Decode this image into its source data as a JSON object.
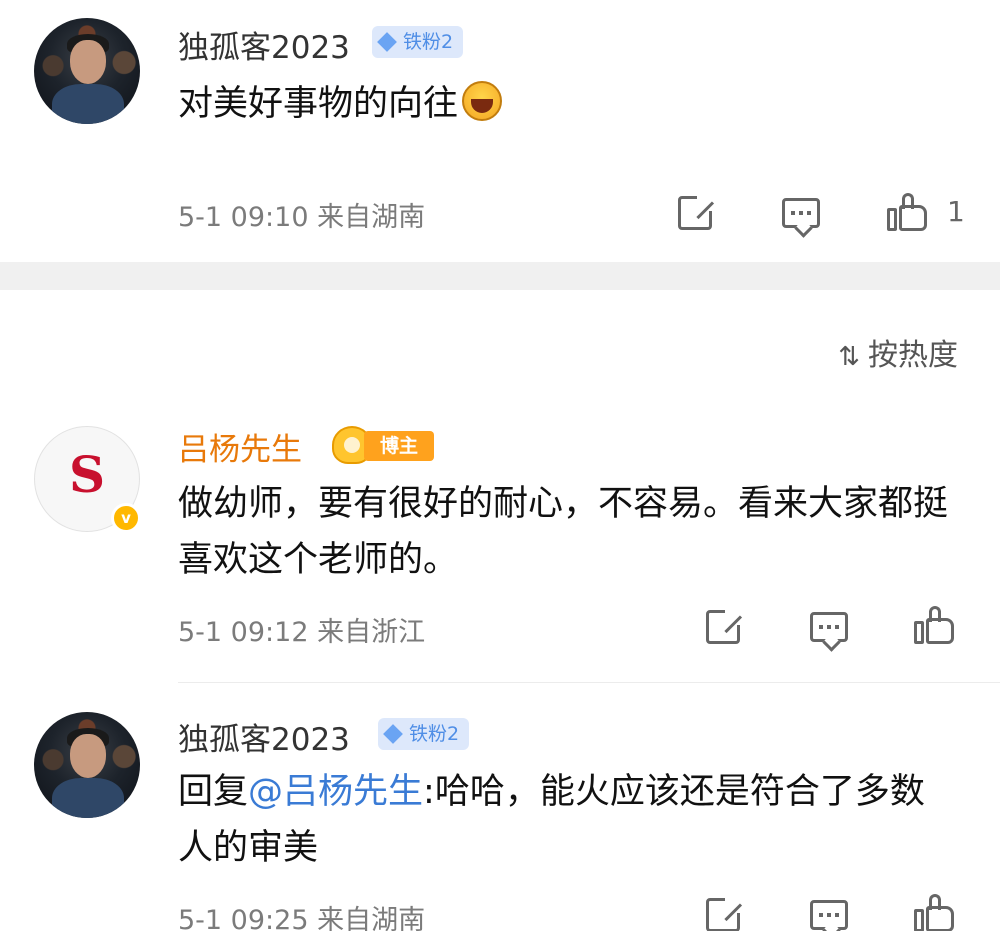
{
  "top_post": {
    "username": "独孤客2023",
    "badge": "铁粉2",
    "text": "对美好事物的向往",
    "emoji": "laughing-emoji",
    "meta": "5-1 09:10 来自湖南",
    "like_count": "1"
  },
  "sort": {
    "icon": "sort-icon",
    "label": "按热度"
  },
  "comments": [
    {
      "username": "吕杨先生",
      "badge": "博主",
      "avatar_letter": "S",
      "verified_mark": "v",
      "text": "做幼师，要有很好的耐心，不容易。看来大家都挺喜欢这个老师的。",
      "meta": "5-1 09:12 来自浙江"
    },
    {
      "username": "独孤客2023",
      "badge": "铁粉2",
      "reply_prefix": "回复",
      "mention": "@吕杨先生",
      "text": ":哈哈，能火应该还是符合了多数人的审美",
      "meta": "5-1 09:25 来自湖南"
    }
  ],
  "colors": {
    "mention": "#3a7bd5",
    "blogger_name": "#e8790a",
    "fan_badge_bg": "#dde8fb",
    "fan_badge_text": "#4f8ee6",
    "blogger_badge": "#ffa21d",
    "meta_text": "#7b7b7b",
    "divider_band": "#f0f0f0"
  }
}
